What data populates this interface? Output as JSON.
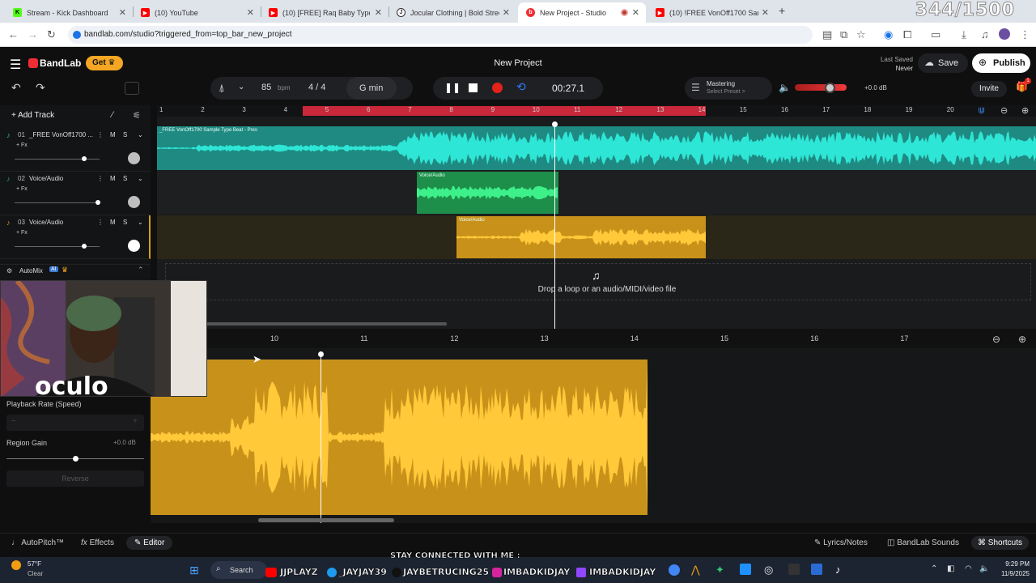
{
  "browser": {
    "tabs": [
      {
        "label": "Stream - Kick Dashboard",
        "icon": "kick-icon",
        "color": "#53fc18"
      },
      {
        "label": "(10) YouTube",
        "icon": "youtube-icon",
        "color": "#ff0000"
      },
      {
        "label": "(10) [FREE] Raq Baby Type Beat",
        "icon": "youtube-icon",
        "color": "#ff0000"
      },
      {
        "label": "Jocular Clothing | Bold Streetw",
        "icon": "jocular-icon",
        "color": "#333333"
      },
      {
        "label": "New Project - Studio",
        "icon": "bandlab-icon",
        "color": "#f02d34"
      },
      {
        "label": "(10) !FREE VonOff1700 Sample T",
        "icon": "youtube-icon",
        "color": "#ff0000"
      }
    ],
    "counter": "344/1500",
    "url": "bandlab.com/studio?triggered_from=top_bar_new_project"
  },
  "header": {
    "logo": "BandLab",
    "get_label": "Get",
    "project_title": "New Project",
    "last_saved_label": "Last Saved",
    "last_saved_value": "Never",
    "save_label": "Save",
    "publish_label": "Publish",
    "invite_label": "Invite",
    "gift_badge": "1"
  },
  "toolbar": {
    "bpm": "85",
    "bpm_unit": "bpm",
    "time_sig": "4 / 4",
    "key": "G min",
    "time": "00:27.1",
    "mastering_label": "Mastering",
    "mastering_sub": "Select Preset >",
    "volume_db": "+0.0 dB",
    "volume_level": 0.67
  },
  "tracklist": {
    "add_track": "Add Track",
    "tracks": [
      {
        "num": "01",
        "name": "_FREE VonOff1700 ...",
        "fx": "+ Fx",
        "color": "#2ec4b6",
        "vol": 0.82
      },
      {
        "num": "02",
        "name": "Voice/Audio",
        "fx": "+ Fx",
        "color": "#27ae60",
        "vol": 0.98
      },
      {
        "num": "03",
        "name": "Voice/Audio",
        "fx": "+ Fx",
        "color": "#d4a017",
        "vol": 0.82
      }
    ],
    "automix": "AutoMix",
    "ai_badge": "AI"
  },
  "ruler": [
    "1",
    "2",
    "3",
    "4",
    "5",
    "6",
    "7",
    "8",
    "9",
    "10",
    "11",
    "12",
    "13",
    "14",
    "15",
    "16",
    "17",
    "18",
    "19",
    "20"
  ],
  "arrangement": {
    "clip1_label": "_FREE VonOff1700 Sample Type Beat - Pres",
    "clip2_label": "Voice/Audio",
    "clip3_label": "Voice/Audio",
    "drop_text": "Drop a loop or an audio/MIDI/video file"
  },
  "editor": {
    "ruler": [
      "10",
      "11",
      "12",
      "13",
      "14",
      "15",
      "16",
      "17"
    ],
    "playback_rate": "Playback Rate (Speed)",
    "region_gain": "Region Gain",
    "region_gain_value": "+0.0 dB",
    "reverse": "Reverse"
  },
  "bottom": {
    "autopitch": "AutoPitch™",
    "effects": "Effects",
    "editor": "Editor",
    "lyrics": "Lyrics/Notes",
    "sounds": "BandLab Sounds",
    "shortcuts": "Shortcuts"
  },
  "taskbar": {
    "temp": "57°F",
    "weather": "Clear",
    "search": "Search",
    "time": "9:29 PM",
    "date": "11/9/2025"
  },
  "overlay": {
    "stay": "STAY CONNECTED WITH ME :",
    "s1": "JJPLAYZ",
    "s2": "_JAYJAY39",
    "s3": "JAYBETRUCING25",
    "s4": "IMBADKIDJAY",
    "s5": "IMBADKIDJAY"
  }
}
